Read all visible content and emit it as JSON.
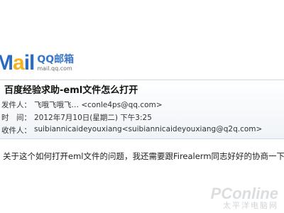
{
  "logo": {
    "brand": "Mail",
    "title": "QQ邮箱",
    "url": "mail.qq.com"
  },
  "email": {
    "subject": "百度经验求助-eml文件怎么打开",
    "sender_label": "发件人：",
    "sender_value": "飞哦飞哦飞… <conle4ps@qq.com>",
    "time_label": "时　间：",
    "time_value": "2012年7月10日(星期二) 下午3:25",
    "recipient_label": "收件人：",
    "recipient_value": "suibiannicaideyouxiang<suibiannicaideyouxiang@q2q.com>",
    "body": "关于这个如何打开eml文件的问题，我还需要跟Firealerm同志好好的协商一下，"
  },
  "watermark": {
    "main": "PConline",
    "sub": "太平洋电脑网"
  },
  "colors": {
    "brand_blue": "#2a6cc4",
    "brand_yellow": "#f2b31c"
  }
}
